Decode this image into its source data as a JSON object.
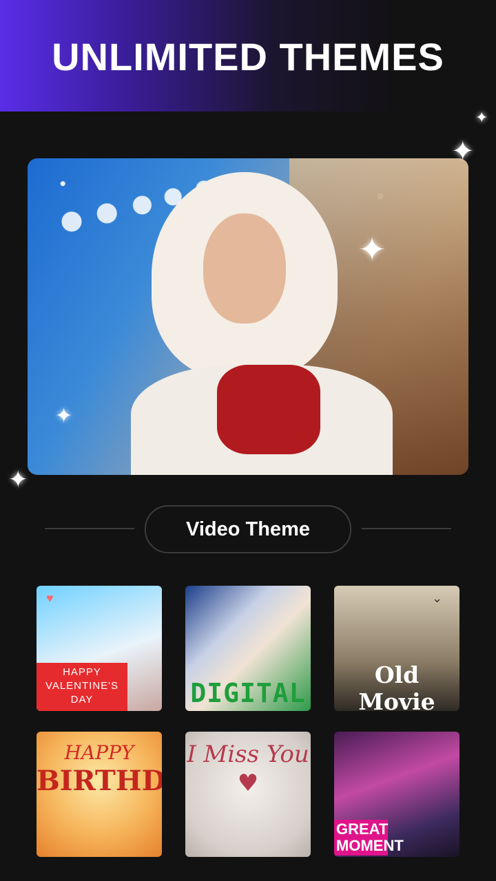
{
  "header": {
    "title": "UNLIMITED THEMES"
  },
  "section": {
    "label": "Video Theme"
  },
  "thumbnails": [
    {
      "id": "valentine",
      "label": "HAPPY VALENTINE'S DAY"
    },
    {
      "id": "digital",
      "label": "DIGITAL"
    },
    {
      "id": "old-movie",
      "label": "Old Movie"
    },
    {
      "id": "birthday",
      "label_small": "HAPPY",
      "label": "BIRTHDAY"
    },
    {
      "id": "miss-you",
      "label": "I Miss You ♥"
    },
    {
      "id": "great-moment",
      "label": "GREAT MOMENT"
    }
  ],
  "colors": {
    "accent": "#5a2de8",
    "background": "#121212"
  }
}
